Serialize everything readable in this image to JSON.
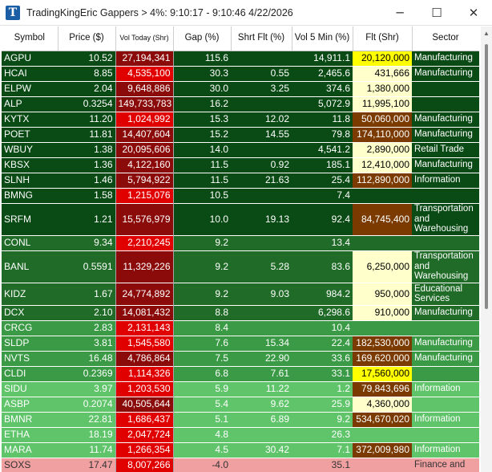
{
  "window": {
    "title": "TradingKingEric Gappers > 4%:  9:10:17 - 9:10:46  4/22/2026",
    "app_icon_letter": "T",
    "min_glyph": "─",
    "max_glyph": "☐",
    "close_glyph": "✕"
  },
  "columns": [
    {
      "key": "sym",
      "label": "Symbol"
    },
    {
      "key": "price",
      "label": "Price ($)"
    },
    {
      "key": "vol",
      "label": "Vol Today (Shr)"
    },
    {
      "key": "gap",
      "label": "Gap (%)"
    },
    {
      "key": "sf",
      "label": "Shrt Flt (%)"
    },
    {
      "key": "v5",
      "label": "Vol 5 Min (%)"
    },
    {
      "key": "flt",
      "label": "Flt (Shr)"
    },
    {
      "key": "sector",
      "label": "Sector"
    }
  ],
  "colors": {
    "row_band_1": "#0a4a14",
    "row_band_2": "#1f6b27",
    "row_band_3": "#3a9a45",
    "row_band_4": "#5fc46a",
    "row_negative": "#f0a0a0",
    "vol_dark_red": "#8b0a0a",
    "vol_red": "#e00000",
    "flt_yellow": "#ffff00",
    "flt_light_yellow": "#ffffcc",
    "flt_brown": "#7a3a00"
  },
  "rows": [
    {
      "sym": "AGPU",
      "price": "10.52",
      "vol": "27,194,341",
      "gap": "115.6",
      "sf": "",
      "v5": "14,911.1",
      "flt": "20,120,000",
      "sector": "Manufacturing",
      "band": "row_band_1",
      "vol_c": "vol_dark_red",
      "flt_c": "flt_yellow"
    },
    {
      "sym": "HCAI",
      "price": "8.85",
      "vol": "4,535,100",
      "gap": "30.3",
      "sf": "0.55",
      "v5": "2,465.6",
      "flt": "431,666",
      "sector": "Manufacturing",
      "band": "row_band_1",
      "vol_c": "vol_red",
      "flt_c": "flt_light_yellow"
    },
    {
      "sym": "ELPW",
      "price": "2.04",
      "vol": "9,648,886",
      "gap": "30.0",
      "sf": "3.25",
      "v5": "374.6",
      "flt": "1,380,000",
      "sector": "",
      "band": "row_band_1",
      "vol_c": "vol_dark_red",
      "flt_c": "flt_light_yellow"
    },
    {
      "sym": "ALP",
      "price": "0.3254",
      "vol": "149,733,783",
      "gap": "16.2",
      "sf": "",
      "v5": "5,072.9",
      "flt": "11,995,100",
      "sector": "",
      "band": "row_band_1",
      "vol_c": "vol_dark_red",
      "flt_c": "flt_light_yellow"
    },
    {
      "sym": "KYTX",
      "price": "11.20",
      "vol": "1,024,992",
      "gap": "15.3",
      "sf": "12.02",
      "v5": "11.8",
      "flt": "50,060,000",
      "sector": "Manufacturing",
      "band": "row_band_1",
      "vol_c": "vol_red",
      "flt_c": "flt_brown"
    },
    {
      "sym": "POET",
      "price": "11.81",
      "vol": "14,407,604",
      "gap": "15.2",
      "sf": "14.55",
      "v5": "79.8",
      "flt": "174,110,000",
      "sector": "Manufacturing",
      "band": "row_band_1",
      "vol_c": "vol_dark_red",
      "flt_c": "flt_brown"
    },
    {
      "sym": "WBUY",
      "price": "1.38",
      "vol": "20,095,606",
      "gap": "14.0",
      "sf": "",
      "v5": "4,541.2",
      "flt": "2,890,000",
      "sector": "Retail Trade",
      "band": "row_band_1",
      "vol_c": "vol_dark_red",
      "flt_c": "flt_light_yellow"
    },
    {
      "sym": "KBSX",
      "price": "1.36",
      "vol": "4,122,160",
      "gap": "11.5",
      "sf": "0.92",
      "v5": "185.1",
      "flt": "12,410,000",
      "sector": "Manufacturing",
      "band": "row_band_1",
      "vol_c": "vol_dark_red",
      "flt_c": "flt_light_yellow"
    },
    {
      "sym": "SLNH",
      "price": "1.46",
      "vol": "5,794,922",
      "gap": "11.5",
      "sf": "21.63",
      "v5": "25.4",
      "flt": "112,890,000",
      "sector": "Information",
      "band": "row_band_1",
      "vol_c": "vol_dark_red",
      "flt_c": "flt_brown"
    },
    {
      "sym": "BMNG",
      "price": "1.58",
      "vol": "1,215,076",
      "gap": "10.5",
      "sf": "",
      "v5": "7.4",
      "flt": "",
      "sector": "",
      "band": "row_band_1",
      "vol_c": "vol_red",
      "flt_c": ""
    },
    {
      "sym": "SRFM",
      "price": "1.21",
      "vol": "15,576,979",
      "gap": "10.0",
      "sf": "19.13",
      "v5": "92.4",
      "flt": "84,745,400",
      "sector": "Transportation and Warehousing",
      "band": "row_band_1",
      "vol_c": "vol_dark_red",
      "flt_c": "flt_brown",
      "tall": true
    },
    {
      "sym": "CONL",
      "price": "9.34",
      "vol": "2,210,245",
      "gap": "9.2",
      "sf": "",
      "v5": "13.4",
      "flt": "",
      "sector": "",
      "band": "row_band_2",
      "vol_c": "vol_red",
      "flt_c": ""
    },
    {
      "sym": "BANL",
      "price": "0.5591",
      "vol": "11,329,226",
      "gap": "9.2",
      "sf": "5.28",
      "v5": "83.6",
      "flt": "6,250,000",
      "sector": "Transportation and Warehousing",
      "band": "row_band_2",
      "vol_c": "vol_dark_red",
      "flt_c": "flt_light_yellow",
      "tall": true
    },
    {
      "sym": "KIDZ",
      "price": "1.67",
      "vol": "24,774,892",
      "gap": "9.2",
      "sf": "9.03",
      "v5": "984.2",
      "flt": "950,000",
      "sector": "Educational Services",
      "band": "row_band_2",
      "vol_c": "vol_dark_red",
      "flt_c": "flt_light_yellow",
      "mid": true
    },
    {
      "sym": "DCX",
      "price": "2.10",
      "vol": "14,081,432",
      "gap": "8.8",
      "sf": "",
      "v5": "6,298.6",
      "flt": "910,000",
      "sector": "Manufacturing",
      "band": "row_band_2",
      "vol_c": "vol_dark_red",
      "flt_c": "flt_light_yellow"
    },
    {
      "sym": "CRCG",
      "price": "2.83",
      "vol": "2,131,143",
      "gap": "8.4",
      "sf": "",
      "v5": "10.4",
      "flt": "",
      "sector": "",
      "band": "row_band_3",
      "vol_c": "vol_red",
      "flt_c": ""
    },
    {
      "sym": "SLDP",
      "price": "3.81",
      "vol": "1,545,580",
      "gap": "7.6",
      "sf": "15.34",
      "v5": "22.4",
      "flt": "182,530,000",
      "sector": "Manufacturing",
      "band": "row_band_3",
      "vol_c": "vol_red",
      "flt_c": "flt_brown"
    },
    {
      "sym": "NVTS",
      "price": "16.48",
      "vol": "4,786,864",
      "gap": "7.5",
      "sf": "22.90",
      "v5": "33.6",
      "flt": "169,620,000",
      "sector": "Manufacturing",
      "band": "row_band_3",
      "vol_c": "vol_dark_red",
      "flt_c": "flt_brown"
    },
    {
      "sym": "CLDI",
      "price": "0.2369",
      "vol": "1,114,326",
      "gap": "6.8",
      "sf": "7.61",
      "v5": "33.1",
      "flt": "17,560,000",
      "sector": "",
      "band": "row_band_3",
      "vol_c": "vol_red",
      "flt_c": "flt_yellow"
    },
    {
      "sym": "SIDU",
      "price": "3.97",
      "vol": "1,203,530",
      "gap": "5.9",
      "sf": "11.22",
      "v5": "1.2",
      "flt": "79,843,696",
      "sector": "Information",
      "band": "row_band_4",
      "vol_c": "vol_red",
      "flt_c": "flt_brown"
    },
    {
      "sym": "ASBP",
      "price": "0.2074",
      "vol": "40,505,644",
      "gap": "5.4",
      "sf": "9.62",
      "v5": "25.9",
      "flt": "4,360,000",
      "sector": "",
      "band": "row_band_4",
      "vol_c": "vol_dark_red",
      "flt_c": "flt_light_yellow"
    },
    {
      "sym": "BMNR",
      "price": "22.81",
      "vol": "1,686,437",
      "gap": "5.1",
      "sf": "6.89",
      "v5": "9.2",
      "flt": "534,670,020",
      "sector": "Information",
      "band": "row_band_4",
      "vol_c": "vol_red",
      "flt_c": "flt_brown"
    },
    {
      "sym": "ETHA",
      "price": "18.19",
      "vol": "2,047,724",
      "gap": "4.8",
      "sf": "",
      "v5": "26.3",
      "flt": "",
      "sector": "",
      "band": "row_band_4",
      "vol_c": "vol_red",
      "flt_c": ""
    },
    {
      "sym": "MARA",
      "price": "11.74",
      "vol": "1,266,354",
      "gap": "4.5",
      "sf": "30.42",
      "v5": "7.1",
      "flt": "372,009,980",
      "sector": "Information",
      "band": "row_band_4",
      "vol_c": "vol_red",
      "flt_c": "flt_brown"
    },
    {
      "sym": "SOXS",
      "price": "17.47",
      "vol": "8,007,266",
      "gap": "-4.0",
      "sf": "",
      "v5": "35.1",
      "flt": "",
      "sector": "Finance and",
      "band": "row_negative",
      "vol_c": "vol_red",
      "flt_c": ""
    }
  ]
}
